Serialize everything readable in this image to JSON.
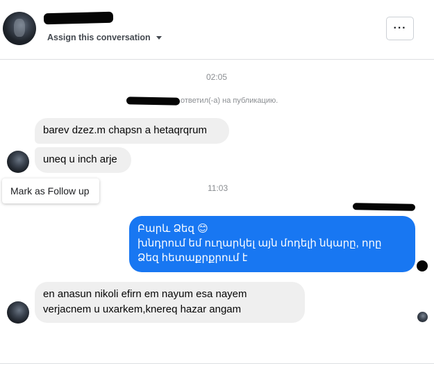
{
  "header": {
    "assign_label": "Assign this conversation",
    "more_label": "···"
  },
  "thread": {
    "timestamp_1": "02:05",
    "notice_text": "ответил(-а) на публикацию.",
    "incoming_1": "barev dzez.m chapsn a hetaqrqrum",
    "incoming_2": "uneq u inch arje",
    "tooltip_label": "Mark as Follow up",
    "timestamp_2": "11:03",
    "outgoing_lines": [
      "Բարև Ձեզ 😊",
      "խնդրում եմ ուղարկել  այն մոդելի նկարը, որը",
      "Ձեզ հետաքրքրում է"
    ],
    "incoming_3_lines": [
      "en anasun nikoli efirn em nayum esa nayem",
      "verjacnem u uxarkem,knereq hazar angam"
    ]
  },
  "colors": {
    "outgoing_bubble": "#1877f2",
    "incoming_bubble": "#efefef",
    "meta_text": "#8a8d91"
  }
}
